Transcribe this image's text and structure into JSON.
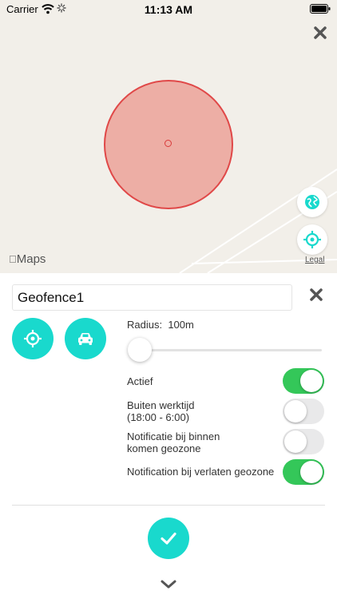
{
  "status_bar": {
    "carrier": "Carrier",
    "time": "11:13 AM",
    "wifi_icon": "wifi-icon",
    "activity_icon": "activity-spinner-icon",
    "battery_icon": "battery-icon"
  },
  "map": {
    "close_icon": "close-icon",
    "geofence_circle_color": "#e04848",
    "geofence_fill_color": "#e98278",
    "globe_icon": "globe-icon",
    "locate_icon": "crosshair-icon",
    "maps_logo": "Maps",
    "legal_link": "Legal"
  },
  "panel": {
    "name_value": "Geofence1",
    "close_icon": "close-icon",
    "crosshair_icon": "crosshair-icon",
    "car_icon": "car-icon",
    "radius_label": "Radius:",
    "radius_value": "100m",
    "radius_slider_fraction": 0.0,
    "options": [
      {
        "label": "Actief",
        "on": true
      },
      {
        "label_line1": "Buiten werktijd",
        "label_line2": "(18:00 - 6:00)",
        "on": false
      },
      {
        "label_line1": "Notificatie bij binnen",
        "label_line2": "komen geozone",
        "on": false
      },
      {
        "label": "Notification bij verlaten geozone",
        "on": true
      }
    ],
    "confirm_icon": "checkmark-icon",
    "expand_icon": "chevron-down-icon"
  },
  "colors": {
    "accent": "#19d9cd",
    "toggle_on": "#34c759",
    "toggle_off": "#e9e9ea",
    "map_background": "#f2efe9"
  }
}
